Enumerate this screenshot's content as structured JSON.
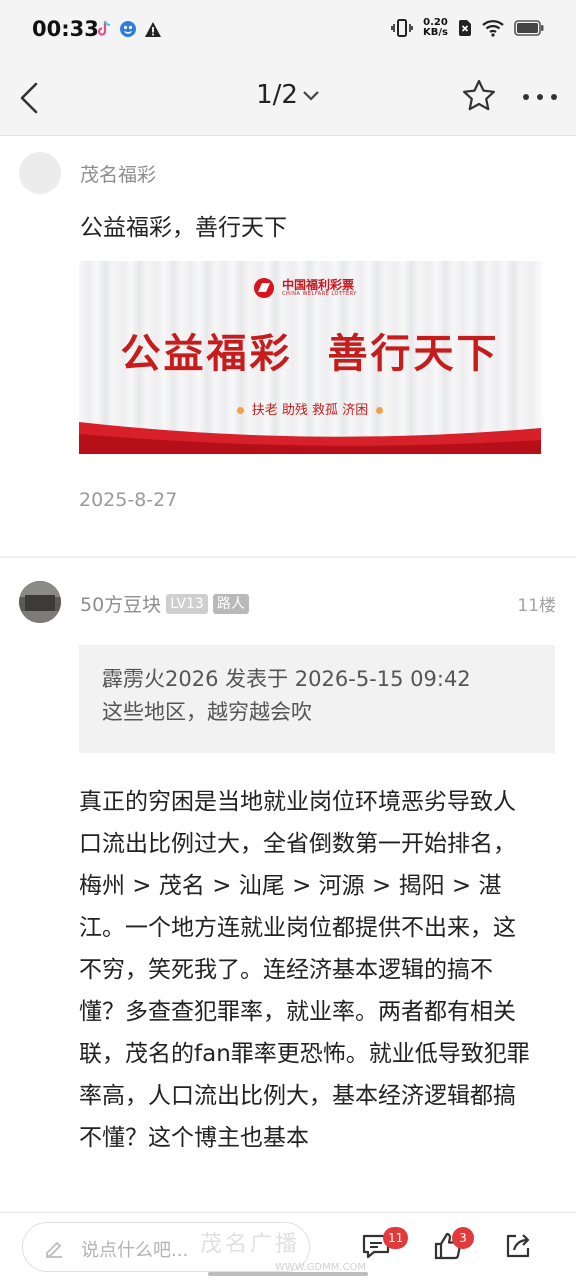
{
  "status_bar": {
    "time": "00:33",
    "net_speed_value": "0.20",
    "net_speed_unit": "KB/s",
    "icons": [
      "tiktok-icon",
      "pet-app-icon",
      "warning-icon",
      "vibrate-icon",
      "sim-x-icon",
      "wifi-icon",
      "battery-icon"
    ]
  },
  "nav": {
    "page_indicator": "1/2",
    "icons": [
      "back-arrow-icon",
      "chevron-down-icon",
      "star-icon",
      "more-icon"
    ]
  },
  "post": {
    "author": "茂名福彩",
    "title": "公益福彩，善行天下",
    "banner": {
      "logo_cn": "中国福利彩票",
      "logo_en": "CHINA WELFARE LOTTERY",
      "slogan": "公益福彩  善行天下",
      "subline": "扶老 助残 救孤 济困"
    },
    "date": "2025-8-27"
  },
  "reply": {
    "author": "50方豆块",
    "level": "LV13",
    "role": "路人",
    "floor": "11楼",
    "quote_header": "霹雳火2026 发表于 2026-5-15 09:42",
    "quote_text": "这些地区，越穷越会吹",
    "body": "真正的穷困是当地就业岗位环境恶劣导致人口流出比例过大，全省倒数第一开始排名，梅州 > 茂名 > 汕尾 > 河源 > 揭阳 > 湛江。一个地方连就业岗位都提供不出来，这不穷，笑死我了。连经济基本逻辑的搞不懂？多查查犯罪率，就业率。两者都有相关联，茂名的fan罪率更恐怖。就业低导致犯罪率高，人口流出比例大，基本经济逻辑都搞不懂？这个博主也基本"
  },
  "bottom_bar": {
    "input_placeholder": "说点什么吧...",
    "comment_count": "11",
    "like_count": "3",
    "watermark": "茂名广播",
    "watermark_url": "WWW.GDMM.COM"
  },
  "colors": {
    "accent_red": "#c61c1c",
    "badge_red": "#e23a3a",
    "muted_text": "#8d8d8d"
  }
}
